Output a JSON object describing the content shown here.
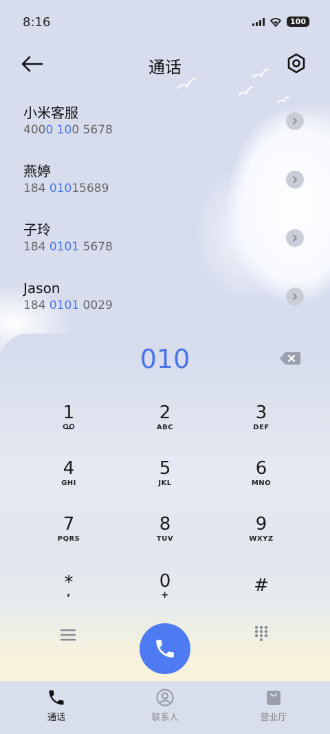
{
  "status_bar": {
    "time": "8:16",
    "battery": "100"
  },
  "header": {
    "title": "通话"
  },
  "contacts": [
    {
      "name": "小米客服",
      "number_parts": [
        "400",
        "0 10",
        "0 5678"
      ]
    },
    {
      "name": "燕婷",
      "number_parts": [
        "184 ",
        "010",
        "15689"
      ]
    },
    {
      "name": "子玲",
      "number_parts": [
        "184 ",
        "0101",
        " 5678"
      ]
    },
    {
      "name": "Jason",
      "number_parts": [
        "184 ",
        "0101",
        " 0029"
      ]
    }
  ],
  "dialer": {
    "dialed_number": "010",
    "keys": [
      {
        "digit": "1",
        "letters": ""
      },
      {
        "digit": "2",
        "letters": "ABC"
      },
      {
        "digit": "3",
        "letters": "DEF"
      },
      {
        "digit": "4",
        "letters": "GHI"
      },
      {
        "digit": "5",
        "letters": "JKL"
      },
      {
        "digit": "6",
        "letters": "MNO"
      },
      {
        "digit": "7",
        "letters": "PQRS"
      },
      {
        "digit": "8",
        "letters": "TUV"
      },
      {
        "digit": "9",
        "letters": "WXYZ"
      },
      {
        "digit": "*",
        "letters": ","
      },
      {
        "digit": "0",
        "letters": "+"
      },
      {
        "digit": "#",
        "letters": ""
      }
    ]
  },
  "bottom_nav": [
    {
      "label": "通话",
      "icon": "phone-icon",
      "active": true
    },
    {
      "label": "联系人",
      "icon": "contact-icon",
      "active": false
    },
    {
      "label": "营业厅",
      "icon": "shopping-bag-icon",
      "active": false
    }
  ],
  "colors": {
    "accent": "#4a74e6",
    "call_button": "#4f7bf2"
  }
}
